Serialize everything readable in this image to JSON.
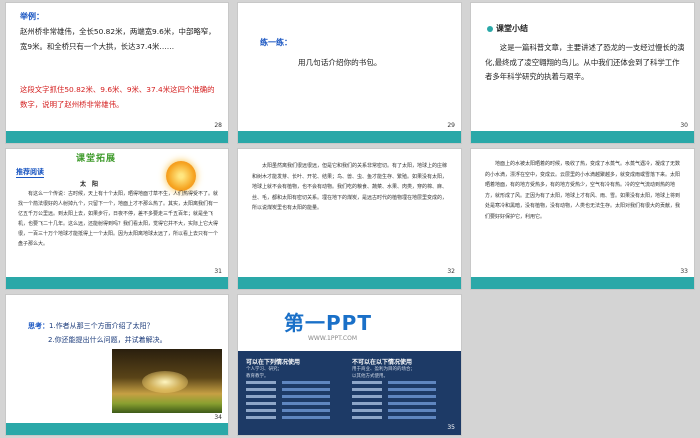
{
  "slides": {
    "s28": {
      "number": "28",
      "label": "举例：",
      "text": "赵州桥非常雄伟，全长50.82米，两端宽9.6米，中部略窄，宽9米。和全桥只有一个大拱，长达37.4米……",
      "red_text": "这段文字抓住50.82米、9.6米、9米、37.4米这四个准确的数字，说明了赵州桥非常雄伟。"
    },
    "s29": {
      "number": "29",
      "label": "练一练：",
      "text": "用几句话介绍你的书包。"
    },
    "s30": {
      "number": "30",
      "heading": "课堂小结",
      "text": "这是一篇科普文章，主要讲述了恐龙的一支经过慢长的演化,最终成了凌空翱翔的鸟儿。从中我们还体会到了科学工作者多年科学研究的执着与艰辛。"
    },
    "s31": {
      "number": "31",
      "banner": "课堂拓展",
      "tag": "推荐阅读",
      "subtitle": "太　阳",
      "text": "有这么一个传说：古时候，天上有十个太阳，晒得地面寸草不生，人们热得受不了。就找一个箭法很好的人射掉九个，只留下一个，地面上才不那么热了。其实，太阳离我们有一亿五千万公里远。到太阳上去，如果步行，日夜不停，差不多要走三千五百年；就是坐飞机，也要飞二十几年。这么远，还能射得到吗？我们看太阳，觉得它并不大，实际上它大得很，一百三十万个地球才能抵得上一个太阳。因为太阳离地球太远了，所以看上去只有一个盘子那么大。"
    },
    "s32": {
      "number": "32",
      "text": "太阳虽然离我们很远很远，但是它和我们的关系非常密切。有了太阳，地球上的庄稼和树木才能发芽、长叶、开花、结果；鸟、兽、虫、鱼才能生存、繁殖。如果没有太阳，地球上就不会有植物，也不会有动物。我们吃的粮食、蔬菜、水果、肉类，穿的棉、麻、丝、毛，都和太阳有密切关系。埋在地下的煤炭，是远古时代的植物埋在地层里变成的，所以说煤炭里也有太阳的能量。"
    },
    "s33": {
      "number": "33",
      "text": "地面上的水被太阳晒着的时候，吸收了热，变成了水蒸气。水蒸气遇冷，凝成了无数的小水滴，漂浮在空中，变成云。云层里的小水滴越聚越多，就变成雨或雪落下来。太阳晒着地面，有的地方受热多，有的地方受热少，空气有冷有热。冷的空气流动到热的地方，就形成了风。正因为有了太阳，地球上才有风、雨、雪。如果没有太阳，地球上将到处是寒冷和黑暗，没有植物，没有动物，人类也无法生存。太阳对我们有很大的贡献，我们要好好保护它，利用它。"
    },
    "s34": {
      "number": "34",
      "label": "思考：",
      "q1": "1.作者从那三个方面介绍了太阳？",
      "q2": "2.你还能提出什么问题，并试着解决。"
    },
    "s35": {
      "number": "35",
      "logo": "第一PPT",
      "url": "WWW.1PPT.COM",
      "left_title": "可以在下列情况使用",
      "left_lines": [
        "个人学习、研究；",
        "教育教学。"
      ],
      "right_title": "不可以在以下情况使用",
      "right_lines": [
        "用于商业、盈利为目的的场合；",
        "以其他方式使用。"
      ]
    }
  },
  "colors": {
    "accent_teal": "#2aa8a8",
    "label_blue": "#1a56c2",
    "highlight_red": "#d42020",
    "banner_green": "#3d9a2a",
    "panel_navy": "#1d3a66"
  }
}
